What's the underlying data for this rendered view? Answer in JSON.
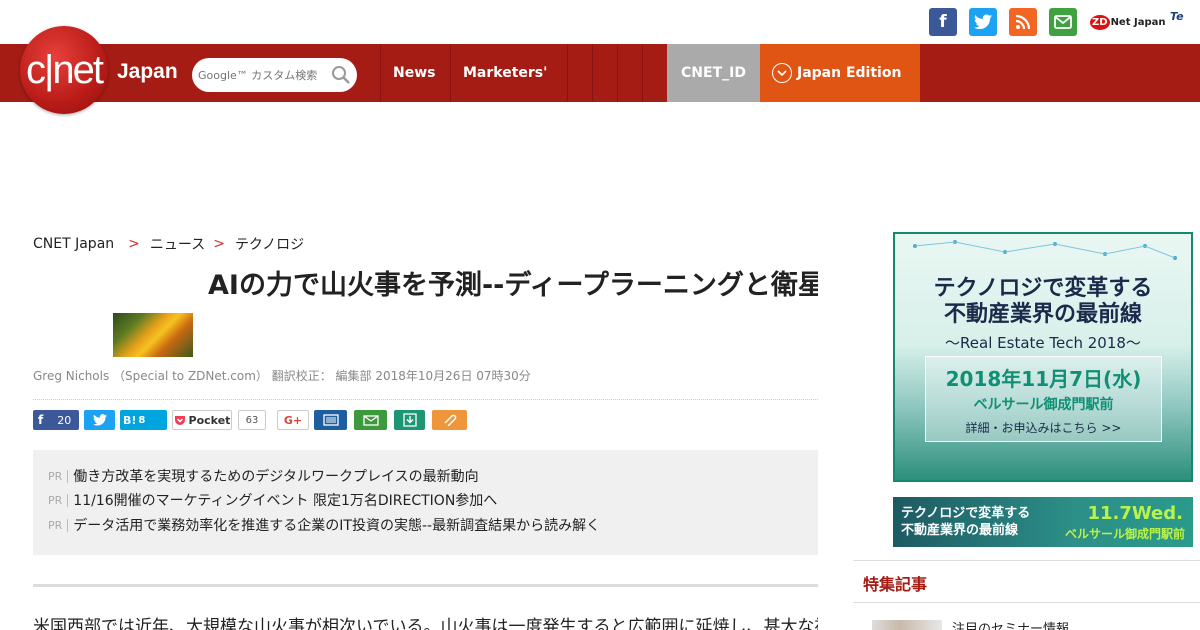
{
  "topbar": {
    "icons": [
      "facebook-icon",
      "twitter-icon",
      "rss-icon",
      "mail-icon"
    ],
    "zdnet_label": "ZD",
    "zdnet_suffix": "Net Japan",
    "te_label": "Te"
  },
  "header": {
    "logo_text": "c|net",
    "logo_japan": "Japan",
    "search_placeholder": "Google™ カスタム検索",
    "nav": [
      "News",
      "Marketers'"
    ],
    "cnet_id": "CNET_ID",
    "edition": "Japan Edition",
    "colors": {
      "header_bg": "#a51c15",
      "cnet_id_bg": "#aaaaaa",
      "edition_bg": "#e05513"
    }
  },
  "breadcrumb": [
    "CNET Japan",
    "ニュース",
    "テクノロジ"
  ],
  "article": {
    "title": "AIの力で山火事を予測--ディープラーニングと衛星画像を活用する最新の取り組み",
    "byline": "Greg Nichols （Special to ZDNet.com） 翻訳校正： 編集部 2018年10月26日 07時30分",
    "body_start": "米国西部では近年、大規模な山火事が相次いでいる。山火事は一度発生すると広範囲に延焼し、甚大な被害をもたらす。"
  },
  "share": {
    "fb_count": "20",
    "hatena_label": "B!",
    "hatena_count": "8",
    "pocket_label": "Pocket",
    "pocket_count": "63",
    "gplus_label": "G+"
  },
  "pr": {
    "tag": "PR",
    "items": [
      "働き方改革を実現するためのデジタルワークプレイスの最新動向",
      "11/16開催のマーケティングイベント 限定1万名DIRECTION参加へ",
      "データ活用で業務効率化を推進する企業のIT投資の実態--最新調査結果から読み解く"
    ]
  },
  "sidebar": {
    "ad1": {
      "headline_1": "テクノロジで変革する",
      "headline_2": "不動産業界の最前線",
      "subtitle": "〜Real Estate Tech 2018〜",
      "date": "2018年11月7日(水)",
      "venue": "ベルサール御成門駅前",
      "cta": "詳細・お申込みはこちら >>"
    },
    "ad2": {
      "line1": "テクノロジで変革する",
      "line2": "不動産業界の最前線",
      "date": "11.7Wed.",
      "venue": "ベルサール御成門駅前"
    },
    "section_title": "特集記事",
    "first_item": "注目のセミナー情報"
  }
}
